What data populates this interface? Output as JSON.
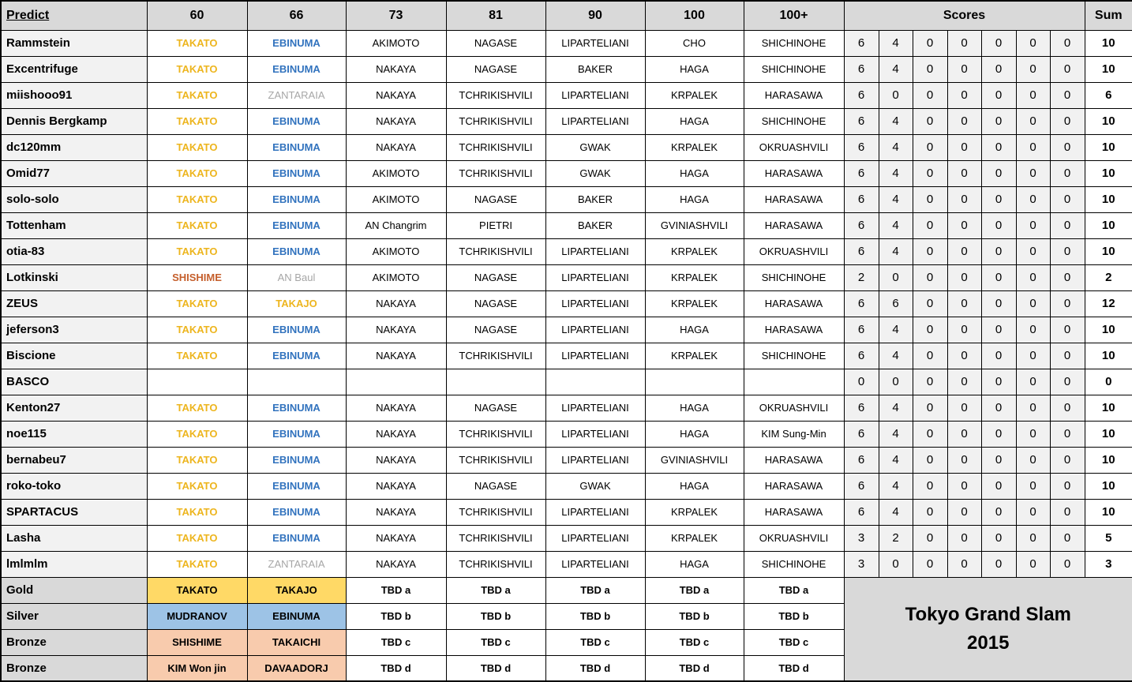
{
  "table": {
    "header": {
      "predict": "Predict",
      "categories": [
        "60",
        "66",
        "73",
        "81",
        "90",
        "100",
        "100+"
      ],
      "scores": "Scores",
      "sum": "Sum"
    },
    "players": [
      {
        "name": "Rammstein",
        "picks": [
          "TAKATO",
          "EBINUMA",
          "AKIMOTO",
          "NAGASE",
          "LIPARTELIANI",
          "CHO",
          "SHICHINOHE"
        ],
        "pick_colors": [
          "gold",
          "blue",
          "",
          "",
          "",
          "",
          ""
        ],
        "scores": [
          "6",
          "4",
          "0",
          "0",
          "0",
          "0",
          "0"
        ],
        "sum": "10"
      },
      {
        "name": "Excentrifuge",
        "picks": [
          "TAKATO",
          "EBINUMA",
          "NAKAYA",
          "NAGASE",
          "BAKER",
          "HAGA",
          "SHICHINOHE"
        ],
        "pick_colors": [
          "gold",
          "blue",
          "",
          "",
          "",
          "",
          ""
        ],
        "scores": [
          "6",
          "4",
          "0",
          "0",
          "0",
          "0",
          "0"
        ],
        "sum": "10"
      },
      {
        "name": "miishooo91",
        "picks": [
          "TAKATO",
          "ZANTARAIA",
          "NAKAYA",
          "TCHRIKISHVILI",
          "LIPARTELIANI",
          "KRPALEK",
          "HARASAWA"
        ],
        "pick_colors": [
          "gold",
          "grey",
          "",
          "",
          "",
          "",
          ""
        ],
        "scores": [
          "6",
          "0",
          "0",
          "0",
          "0",
          "0",
          "0"
        ],
        "sum": "6"
      },
      {
        "name": "Dennis Bergkamp",
        "picks": [
          "TAKATO",
          "EBINUMA",
          "NAKAYA",
          "TCHRIKISHVILI",
          "LIPARTELIANI",
          "HAGA",
          "SHICHINOHE"
        ],
        "pick_colors": [
          "gold",
          "blue",
          "",
          "",
          "",
          "",
          ""
        ],
        "scores": [
          "6",
          "4",
          "0",
          "0",
          "0",
          "0",
          "0"
        ],
        "sum": "10"
      },
      {
        "name": "dc120mm",
        "picks": [
          "TAKATO",
          "EBINUMA",
          "NAKAYA",
          "TCHRIKISHVILI",
          "GWAK",
          "KRPALEK",
          "OKRUASHVILI"
        ],
        "pick_colors": [
          "gold",
          "blue",
          "",
          "",
          "",
          "",
          ""
        ],
        "scores": [
          "6",
          "4",
          "0",
          "0",
          "0",
          "0",
          "0"
        ],
        "sum": "10"
      },
      {
        "name": "Omid77",
        "picks": [
          "TAKATO",
          "EBINUMA",
          "AKIMOTO",
          "TCHRIKISHVILI",
          "GWAK",
          "HAGA",
          "HARASAWA"
        ],
        "pick_colors": [
          "gold",
          "blue",
          "",
          "",
          "",
          "",
          ""
        ],
        "scores": [
          "6",
          "4",
          "0",
          "0",
          "0",
          "0",
          "0"
        ],
        "sum": "10"
      },
      {
        "name": "solo-solo",
        "picks": [
          "TAKATO",
          "EBINUMA",
          "AKIMOTO",
          "NAGASE",
          "BAKER",
          "HAGA",
          "HARASAWA"
        ],
        "pick_colors": [
          "gold",
          "blue",
          "",
          "",
          "",
          "",
          ""
        ],
        "scores": [
          "6",
          "4",
          "0",
          "0",
          "0",
          "0",
          "0"
        ],
        "sum": "10"
      },
      {
        "name": "Tottenham",
        "picks": [
          "TAKATO",
          "EBINUMA",
          "AN Changrim",
          "PIETRI",
          "BAKER",
          "GVINIASHVILI",
          "HARASAWA"
        ],
        "pick_colors": [
          "gold",
          "blue",
          "",
          "",
          "",
          "",
          ""
        ],
        "scores": [
          "6",
          "4",
          "0",
          "0",
          "0",
          "0",
          "0"
        ],
        "sum": "10"
      },
      {
        "name": "otia-83",
        "picks": [
          "TAKATO",
          "EBINUMA",
          "AKIMOTO",
          "TCHRIKISHVILI",
          "LIPARTELIANI",
          "KRPALEK",
          "OKRUASHVILI"
        ],
        "pick_colors": [
          "gold",
          "blue",
          "",
          "",
          "",
          "",
          ""
        ],
        "scores": [
          "6",
          "4",
          "0",
          "0",
          "0",
          "0",
          "0"
        ],
        "sum": "10"
      },
      {
        "name": "Lotkinski",
        "picks": [
          "SHISHIME",
          "AN Baul",
          "AKIMOTO",
          "NAGASE",
          "LIPARTELIANI",
          "KRPALEK",
          "SHICHINOHE"
        ],
        "pick_colors": [
          "orange",
          "grey",
          "",
          "",
          "",
          "",
          ""
        ],
        "scores": [
          "2",
          "0",
          "0",
          "0",
          "0",
          "0",
          "0"
        ],
        "sum": "2"
      },
      {
        "name": "ZEUS",
        "picks": [
          "TAKATO",
          "TAKAJO",
          "NAKAYA",
          "NAGASE",
          "LIPARTELIANI",
          "KRPALEK",
          "HARASAWA"
        ],
        "pick_colors": [
          "gold",
          "gold",
          "",
          "",
          "",
          "",
          ""
        ],
        "scores": [
          "6",
          "6",
          "0",
          "0",
          "0",
          "0",
          "0"
        ],
        "sum": "12"
      },
      {
        "name": "jeferson3",
        "picks": [
          "TAKATO",
          "EBINUMA",
          "NAKAYA",
          "NAGASE",
          "LIPARTELIANI",
          "HAGA",
          "HARASAWA"
        ],
        "pick_colors": [
          "gold",
          "blue",
          "",
          "",
          "",
          "",
          ""
        ],
        "scores": [
          "6",
          "4",
          "0",
          "0",
          "0",
          "0",
          "0"
        ],
        "sum": "10"
      },
      {
        "name": "Biscione",
        "picks": [
          "TAKATO",
          "EBINUMA",
          "NAKAYA",
          "TCHRIKISHVILI",
          "LIPARTELIANI",
          "KRPALEK",
          "SHICHINOHE"
        ],
        "pick_colors": [
          "gold",
          "blue",
          "",
          "",
          "",
          "",
          ""
        ],
        "scores": [
          "6",
          "4",
          "0",
          "0",
          "0",
          "0",
          "0"
        ],
        "sum": "10"
      },
      {
        "name": "BASCO",
        "picks": [
          "",
          "",
          "",
          "",
          "",
          "",
          ""
        ],
        "pick_colors": [
          "",
          "",
          "",
          "",
          "",
          "",
          ""
        ],
        "scores": [
          "0",
          "0",
          "0",
          "0",
          "0",
          "0",
          "0"
        ],
        "sum": "0"
      },
      {
        "name": "Kenton27",
        "picks": [
          "TAKATO",
          "EBINUMA",
          "NAKAYA",
          "NAGASE",
          "LIPARTELIANI",
          "HAGA",
          "OKRUASHVILI"
        ],
        "pick_colors": [
          "gold",
          "blue",
          "",
          "",
          "",
          "",
          ""
        ],
        "scores": [
          "6",
          "4",
          "0",
          "0",
          "0",
          "0",
          "0"
        ],
        "sum": "10"
      },
      {
        "name": "noe115",
        "picks": [
          "TAKATO",
          "EBINUMA",
          "NAKAYA",
          "TCHRIKISHVILI",
          "LIPARTELIANI",
          "HAGA",
          "KIM Sung-Min"
        ],
        "pick_colors": [
          "gold",
          "blue",
          "",
          "",
          "",
          "",
          ""
        ],
        "scores": [
          "6",
          "4",
          "0",
          "0",
          "0",
          "0",
          "0"
        ],
        "sum": "10"
      },
      {
        "name": "bernabeu7",
        "picks": [
          "TAKATO",
          "EBINUMA",
          "NAKAYA",
          "TCHRIKISHVILI",
          "LIPARTELIANI",
          "GVINIASHVILI",
          "HARASAWA"
        ],
        "pick_colors": [
          "gold",
          "blue",
          "",
          "",
          "",
          "",
          ""
        ],
        "scores": [
          "6",
          "4",
          "0",
          "0",
          "0",
          "0",
          "0"
        ],
        "sum": "10"
      },
      {
        "name": "roko-toko",
        "picks": [
          "TAKATO",
          "EBINUMA",
          "NAKAYA",
          "NAGASE",
          "GWAK",
          "HAGA",
          "HARASAWA"
        ],
        "pick_colors": [
          "gold",
          "blue",
          "",
          "",
          "",
          "",
          ""
        ],
        "scores": [
          "6",
          "4",
          "0",
          "0",
          "0",
          "0",
          "0"
        ],
        "sum": "10"
      },
      {
        "name": "SPARTACUS",
        "picks": [
          "TAKATO",
          "EBINUMA",
          "NAKAYA",
          "TCHRIKISHVILI",
          "LIPARTELIANI",
          "KRPALEK",
          "HARASAWA"
        ],
        "pick_colors": [
          "gold",
          "blue",
          "",
          "",
          "",
          "",
          ""
        ],
        "scores": [
          "6",
          "4",
          "0",
          "0",
          "0",
          "0",
          "0"
        ],
        "sum": "10"
      },
      {
        "name": "Lasha",
        "picks": [
          "TAKATO",
          "EBINUMA",
          "NAKAYA",
          "TCHRIKISHVILI",
          "LIPARTELIANI",
          "KRPALEK",
          "OKRUASHVILI"
        ],
        "pick_colors": [
          "gold",
          "blue",
          "",
          "",
          "",
          "",
          ""
        ],
        "scores": [
          "3",
          "2",
          "0",
          "0",
          "0",
          "0",
          "0"
        ],
        "sum": "5"
      },
      {
        "name": "lmlmlm",
        "picks": [
          "TAKATO",
          "ZANTARAIA",
          "NAKAYA",
          "TCHRIKISHVILI",
          "LIPARTELIANI",
          "HAGA",
          "SHICHINOHE"
        ],
        "pick_colors": [
          "gold",
          "grey",
          "",
          "",
          "",
          "",
          ""
        ],
        "scores": [
          "3",
          "0",
          "0",
          "0",
          "0",
          "0",
          "0"
        ],
        "sum": "3"
      }
    ],
    "medals": [
      {
        "label": "Gold",
        "bg": "gold",
        "winners": [
          "TAKATO",
          "TAKAJO"
        ],
        "tbd": [
          "TBD a",
          "TBD a",
          "TBD a",
          "TBD a",
          "TBD a"
        ]
      },
      {
        "label": "Silver",
        "bg": "silver",
        "winners": [
          "MUDRANOV",
          "EBINUMA"
        ],
        "tbd": [
          "TBD b",
          "TBD b",
          "TBD b",
          "TBD b",
          "TBD b"
        ]
      },
      {
        "label": "Bronze",
        "bg": "bronze",
        "winners": [
          "SHISHIME",
          "TAKAICHI"
        ],
        "tbd": [
          "TBD c",
          "TBD c",
          "TBD c",
          "TBD c",
          "TBD c"
        ]
      },
      {
        "label": "Bronze",
        "bg": "bronze",
        "winners": [
          "KIM Won jin",
          "DAVAADORJ"
        ],
        "tbd": [
          "TBD d",
          "TBD d",
          "TBD d",
          "TBD d",
          "TBD d"
        ]
      }
    ],
    "footer": {
      "line1": "Tokyo Grand Slam",
      "line2": "2015"
    }
  },
  "colors": {
    "header_bg": "#D9D9D9",
    "name_col_bg": "#F2F2F2",
    "score_bg": "#F1F1F1",
    "medal_label_bg": "#D9D9D9",
    "footer_bg": "#D9D9D9",
    "text_gold": "#EDB51E",
    "text_blue": "#3273BE",
    "text_grey": "#A6A6A6",
    "text_orange": "#C55F2C",
    "bg_gold": "#FFD966",
    "bg_silver": "#9DC3E6",
    "bg_bronze": "#F8CBAD"
  }
}
